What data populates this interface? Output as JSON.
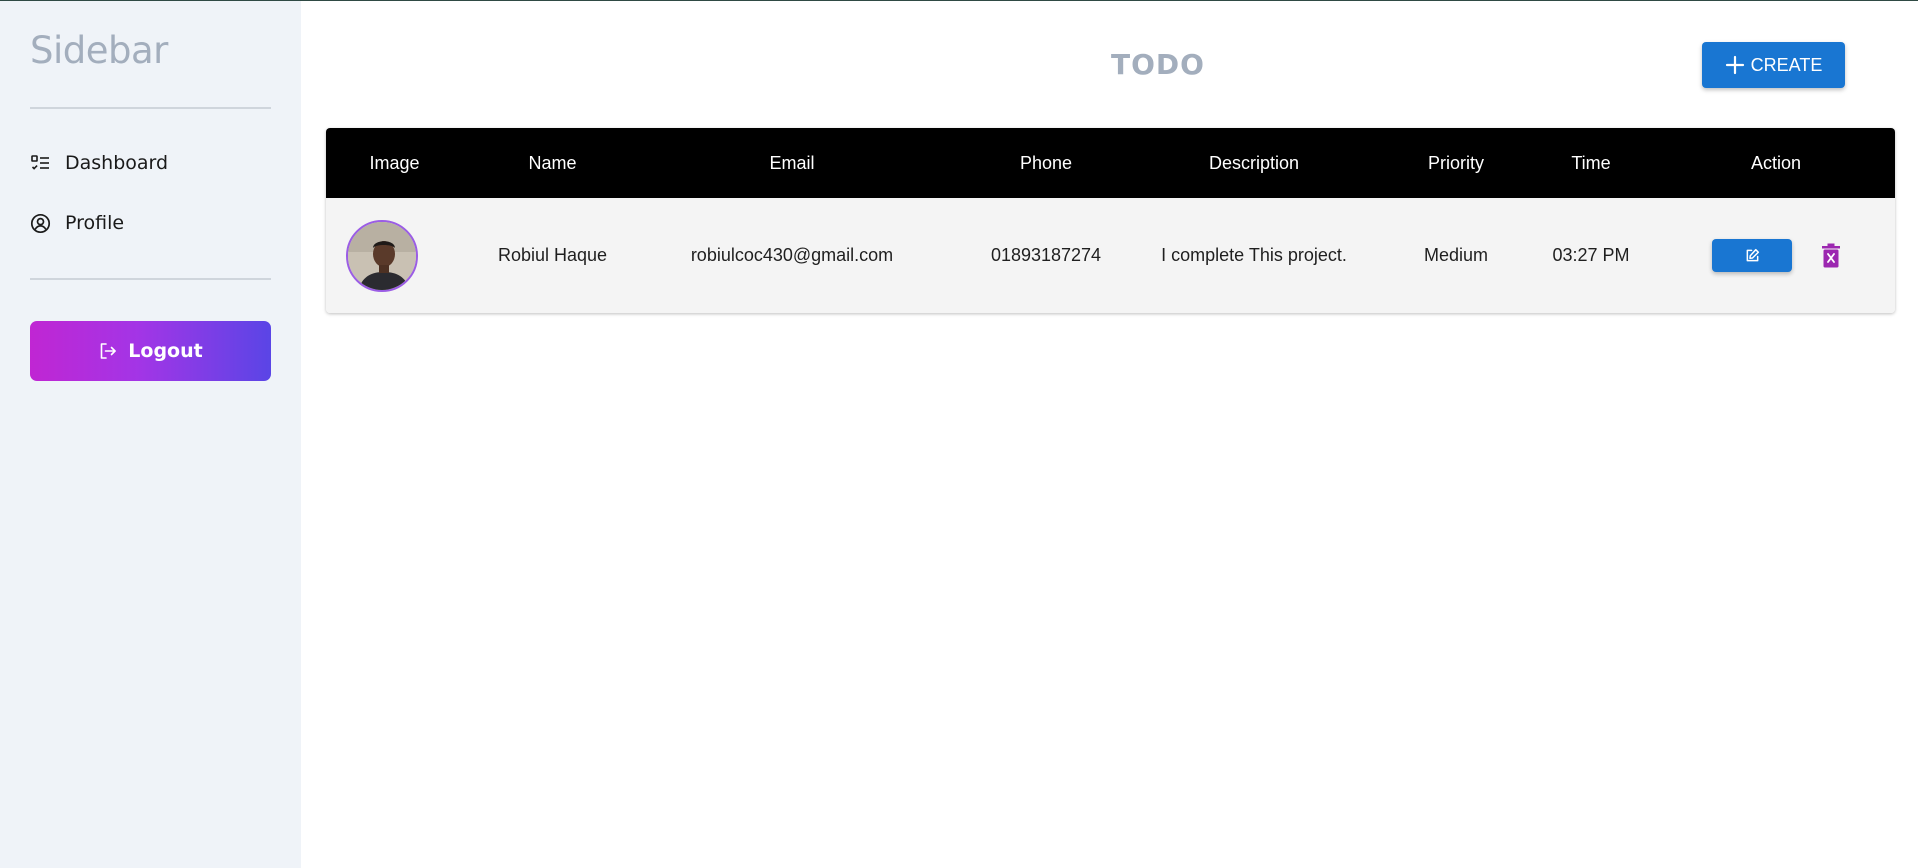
{
  "sidebar": {
    "title": "Sidebar",
    "items": [
      {
        "label": "Dashboard",
        "icon": "checklist-icon"
      },
      {
        "label": "Profile",
        "icon": "user-circle-icon"
      }
    ],
    "logout": {
      "label": "Logout",
      "icon": "logout-icon"
    }
  },
  "header": {
    "title": "TODO",
    "create_label": "CREATE",
    "create_icon": "plus-icon"
  },
  "table": {
    "columns": [
      "Image",
      "Name",
      "Email",
      "Phone",
      "Description",
      "Priority",
      "Time",
      "Action"
    ],
    "rows": [
      {
        "name": "Robiul Haque",
        "email": "robiulcoc430@gmail.com",
        "phone": "01893187274",
        "description": "I complete This project.",
        "priority": "Medium",
        "time": "03:27 PM"
      }
    ]
  },
  "colors": {
    "primary": "#1976d2",
    "sidebar_bg": "#eff3f8",
    "logout_gradient_start": "#c026d3",
    "logout_gradient_end": "#5a45e6",
    "delete": "#9c27b0"
  }
}
